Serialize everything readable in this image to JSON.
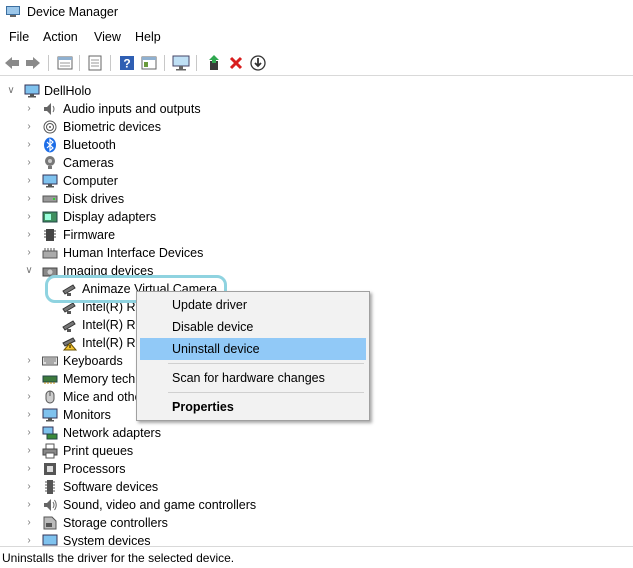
{
  "window": {
    "title": "Device Manager"
  },
  "menu": [
    "File",
    "Action",
    "View",
    "Help"
  ],
  "toolbar_icons": [
    "back-icon",
    "forward-icon",
    "properties-icon",
    "driver-icon",
    "help-icon",
    "view-icon",
    "monitor-icon",
    "update-driver-icon",
    "uninstall-icon",
    "download-icon"
  ],
  "tree": {
    "root": "DellHolo",
    "categories": [
      {
        "label": "Audio inputs and outputs",
        "icon": "speaker-icon"
      },
      {
        "label": "Biometric devices",
        "icon": "fingerprint-icon"
      },
      {
        "label": "Bluetooth",
        "icon": "bluetooth-icon"
      },
      {
        "label": "Cameras",
        "icon": "camera-icon"
      },
      {
        "label": "Computer",
        "icon": "computer-icon"
      },
      {
        "label": "Disk drives",
        "icon": "disk-icon"
      },
      {
        "label": "Display adapters",
        "icon": "display-adapter-icon"
      },
      {
        "label": "Firmware",
        "icon": "chip-icon"
      },
      {
        "label": "Human Interface Devices",
        "icon": "hid-icon"
      },
      {
        "label": "Imaging devices",
        "icon": "imaging-icon"
      }
    ],
    "imaging_children": [
      {
        "label": "Animaze Virtual Camera"
      },
      {
        "label": "Intel(R) Re"
      },
      {
        "label": "Intel(R) Re"
      },
      {
        "label": "Intel(R) Re"
      }
    ],
    "categories_after": [
      {
        "label": "Keyboards",
        "icon": "keyboard-icon"
      },
      {
        "label": "Memory techn",
        "icon": "memory-icon"
      },
      {
        "label": "Mice and othe",
        "icon": "mouse-icon"
      },
      {
        "label": "Monitors",
        "icon": "monitor-icon"
      },
      {
        "label": "Network adapters",
        "icon": "network-icon"
      },
      {
        "label": "Print queues",
        "icon": "printer-icon"
      },
      {
        "label": "Processors",
        "icon": "processor-icon"
      },
      {
        "label": "Software devices",
        "icon": "software-icon"
      },
      {
        "label": "Sound, video and game controllers",
        "icon": "sound-icon"
      },
      {
        "label": "Storage controllers",
        "icon": "storage-icon"
      },
      {
        "label": "System devices",
        "icon": "system-icon"
      }
    ]
  },
  "context_menu": {
    "update": "Update driver",
    "disable": "Disable device",
    "uninstall": "Uninstall device",
    "scan": "Scan for hardware changes",
    "properties": "Properties"
  },
  "status": "Uninstalls the driver for the selected device."
}
